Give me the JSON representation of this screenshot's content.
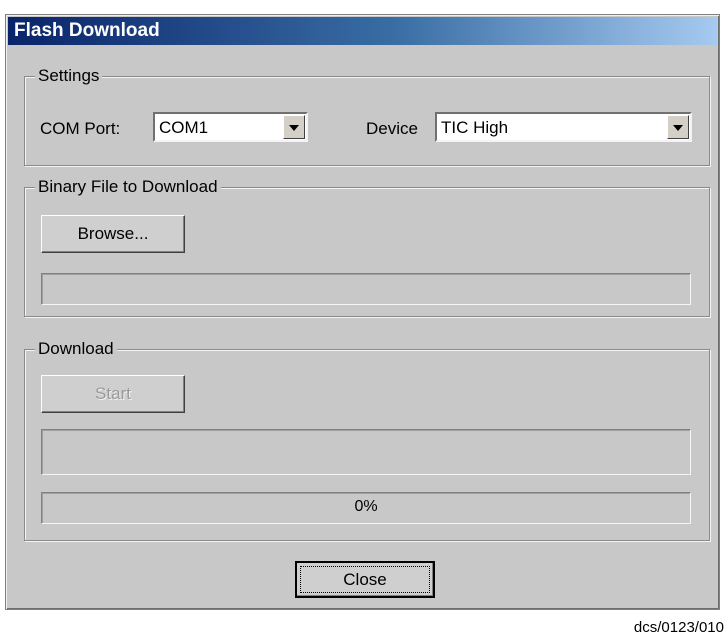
{
  "window": {
    "title": "Flash Download"
  },
  "settings": {
    "legend": "Settings",
    "com_port_label": "COM Port:",
    "com_port_value": "COM1",
    "device_label": "Device",
    "device_value": "TIC High"
  },
  "binary_file": {
    "legend": "Binary File to Download",
    "browse_label": "Browse...",
    "file_path": ""
  },
  "download": {
    "legend": "Download",
    "start_label": "Start",
    "status_text": "",
    "progress_text": "0%",
    "progress_percent": 0
  },
  "close_label": "Close",
  "caption": "dcs/0123/010"
}
